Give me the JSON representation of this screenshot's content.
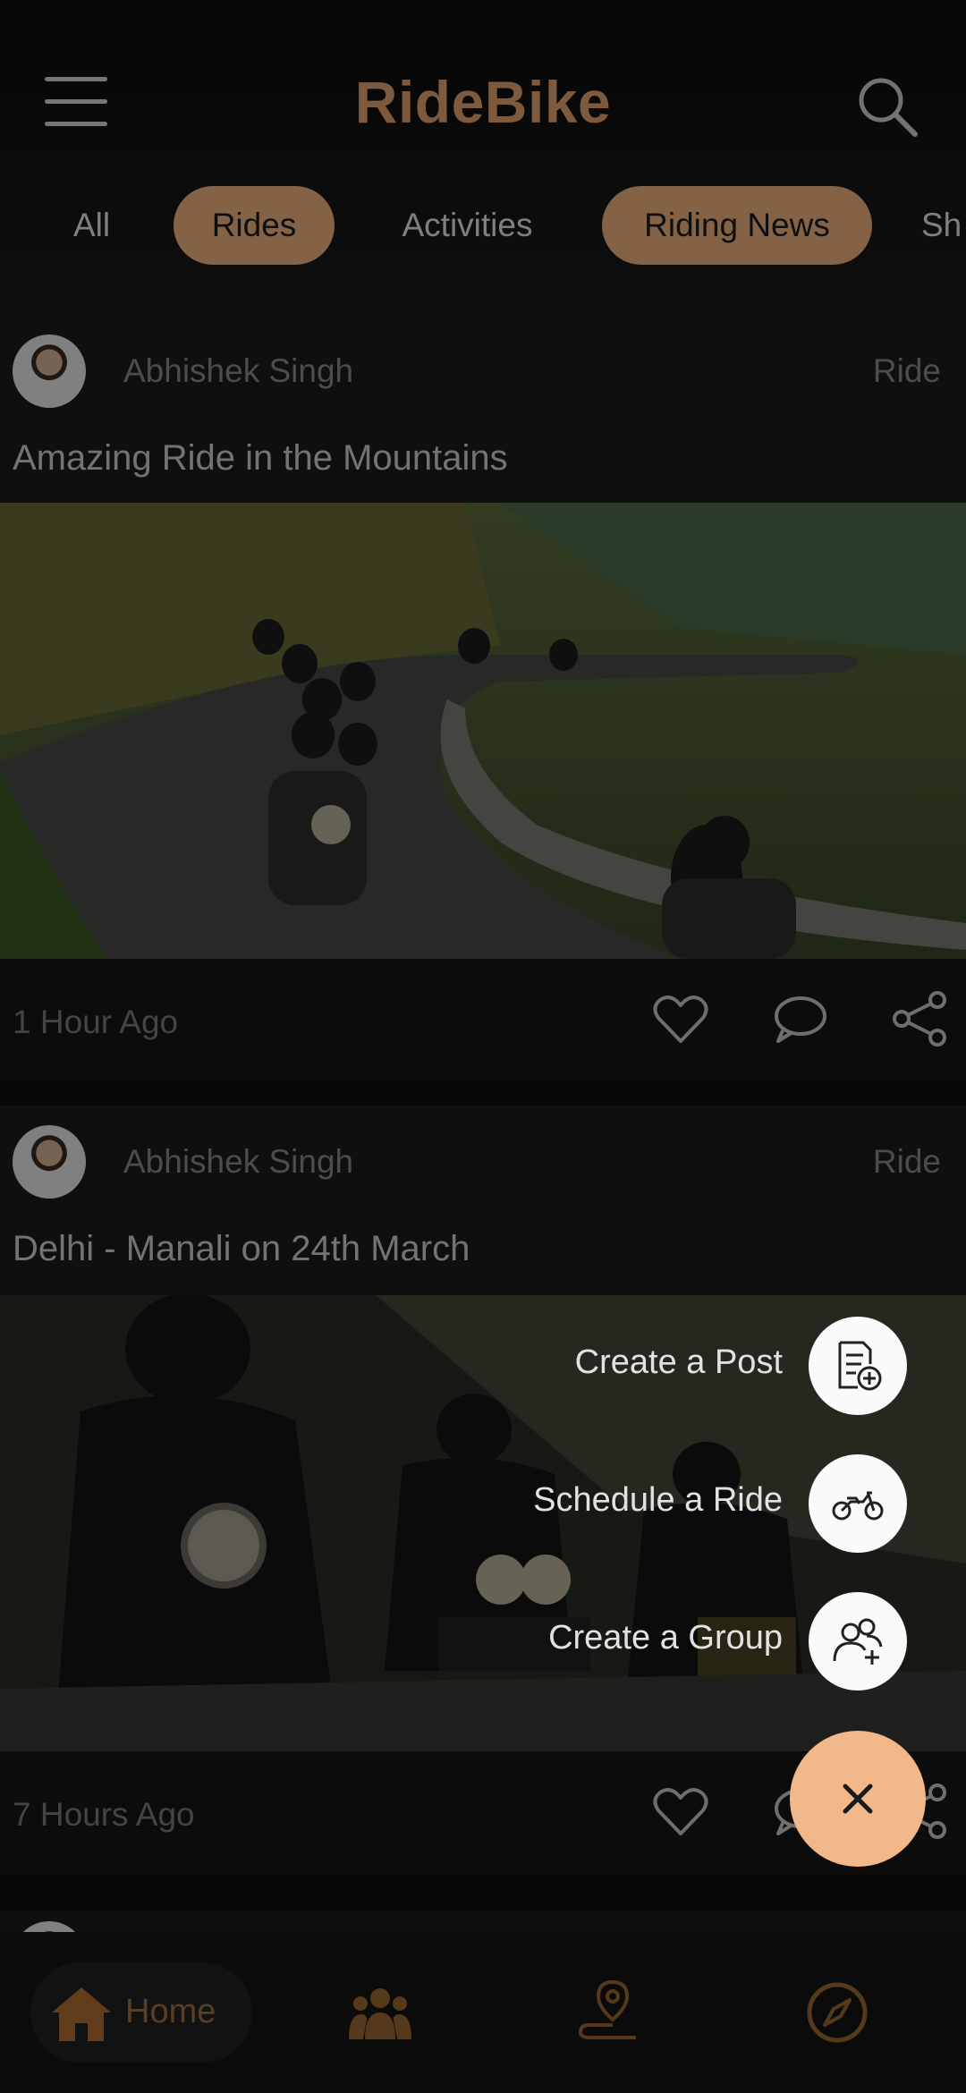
{
  "app": {
    "title": "RideBike"
  },
  "header": {
    "menu_icon": "hamburger-icon",
    "search_icon": "search-icon",
    "chips": [
      {
        "label": "All",
        "active": false
      },
      {
        "label": "Rides",
        "active": true
      },
      {
        "label": "Activities",
        "active": false
      },
      {
        "label": "Riding News",
        "active": true
      },
      {
        "label": "Sh",
        "active": false
      }
    ]
  },
  "posts": [
    {
      "author": "Abhishek Singh",
      "type": "Ride",
      "title": "Amazing Ride in the Mountains",
      "time": "1 Hour Ago",
      "image": "group-of-motorcycles-on-mountain-road"
    },
    {
      "author": "Abhishek Singh",
      "type": "Ride",
      "title": "Delhi - Manali on 24th March",
      "time": "7 Hours Ago",
      "image": "riders-on-motorcycles-closeup"
    }
  ],
  "fab_menu": {
    "items": [
      {
        "label": "Create a Post",
        "icon": "create-post-icon"
      },
      {
        "label": "Schedule a Ride",
        "icon": "motorcycle-icon"
      },
      {
        "label": "Create a Group",
        "icon": "add-group-icon"
      }
    ],
    "close_icon": "close-icon"
  },
  "bottom_nav": {
    "home_label": "Home",
    "items": [
      "home-icon",
      "community-icon",
      "route-icon",
      "compass-icon"
    ]
  },
  "colors": {
    "accent": "#f0b380",
    "brand": "#e4a46f",
    "background": "#1b1b1b"
  }
}
